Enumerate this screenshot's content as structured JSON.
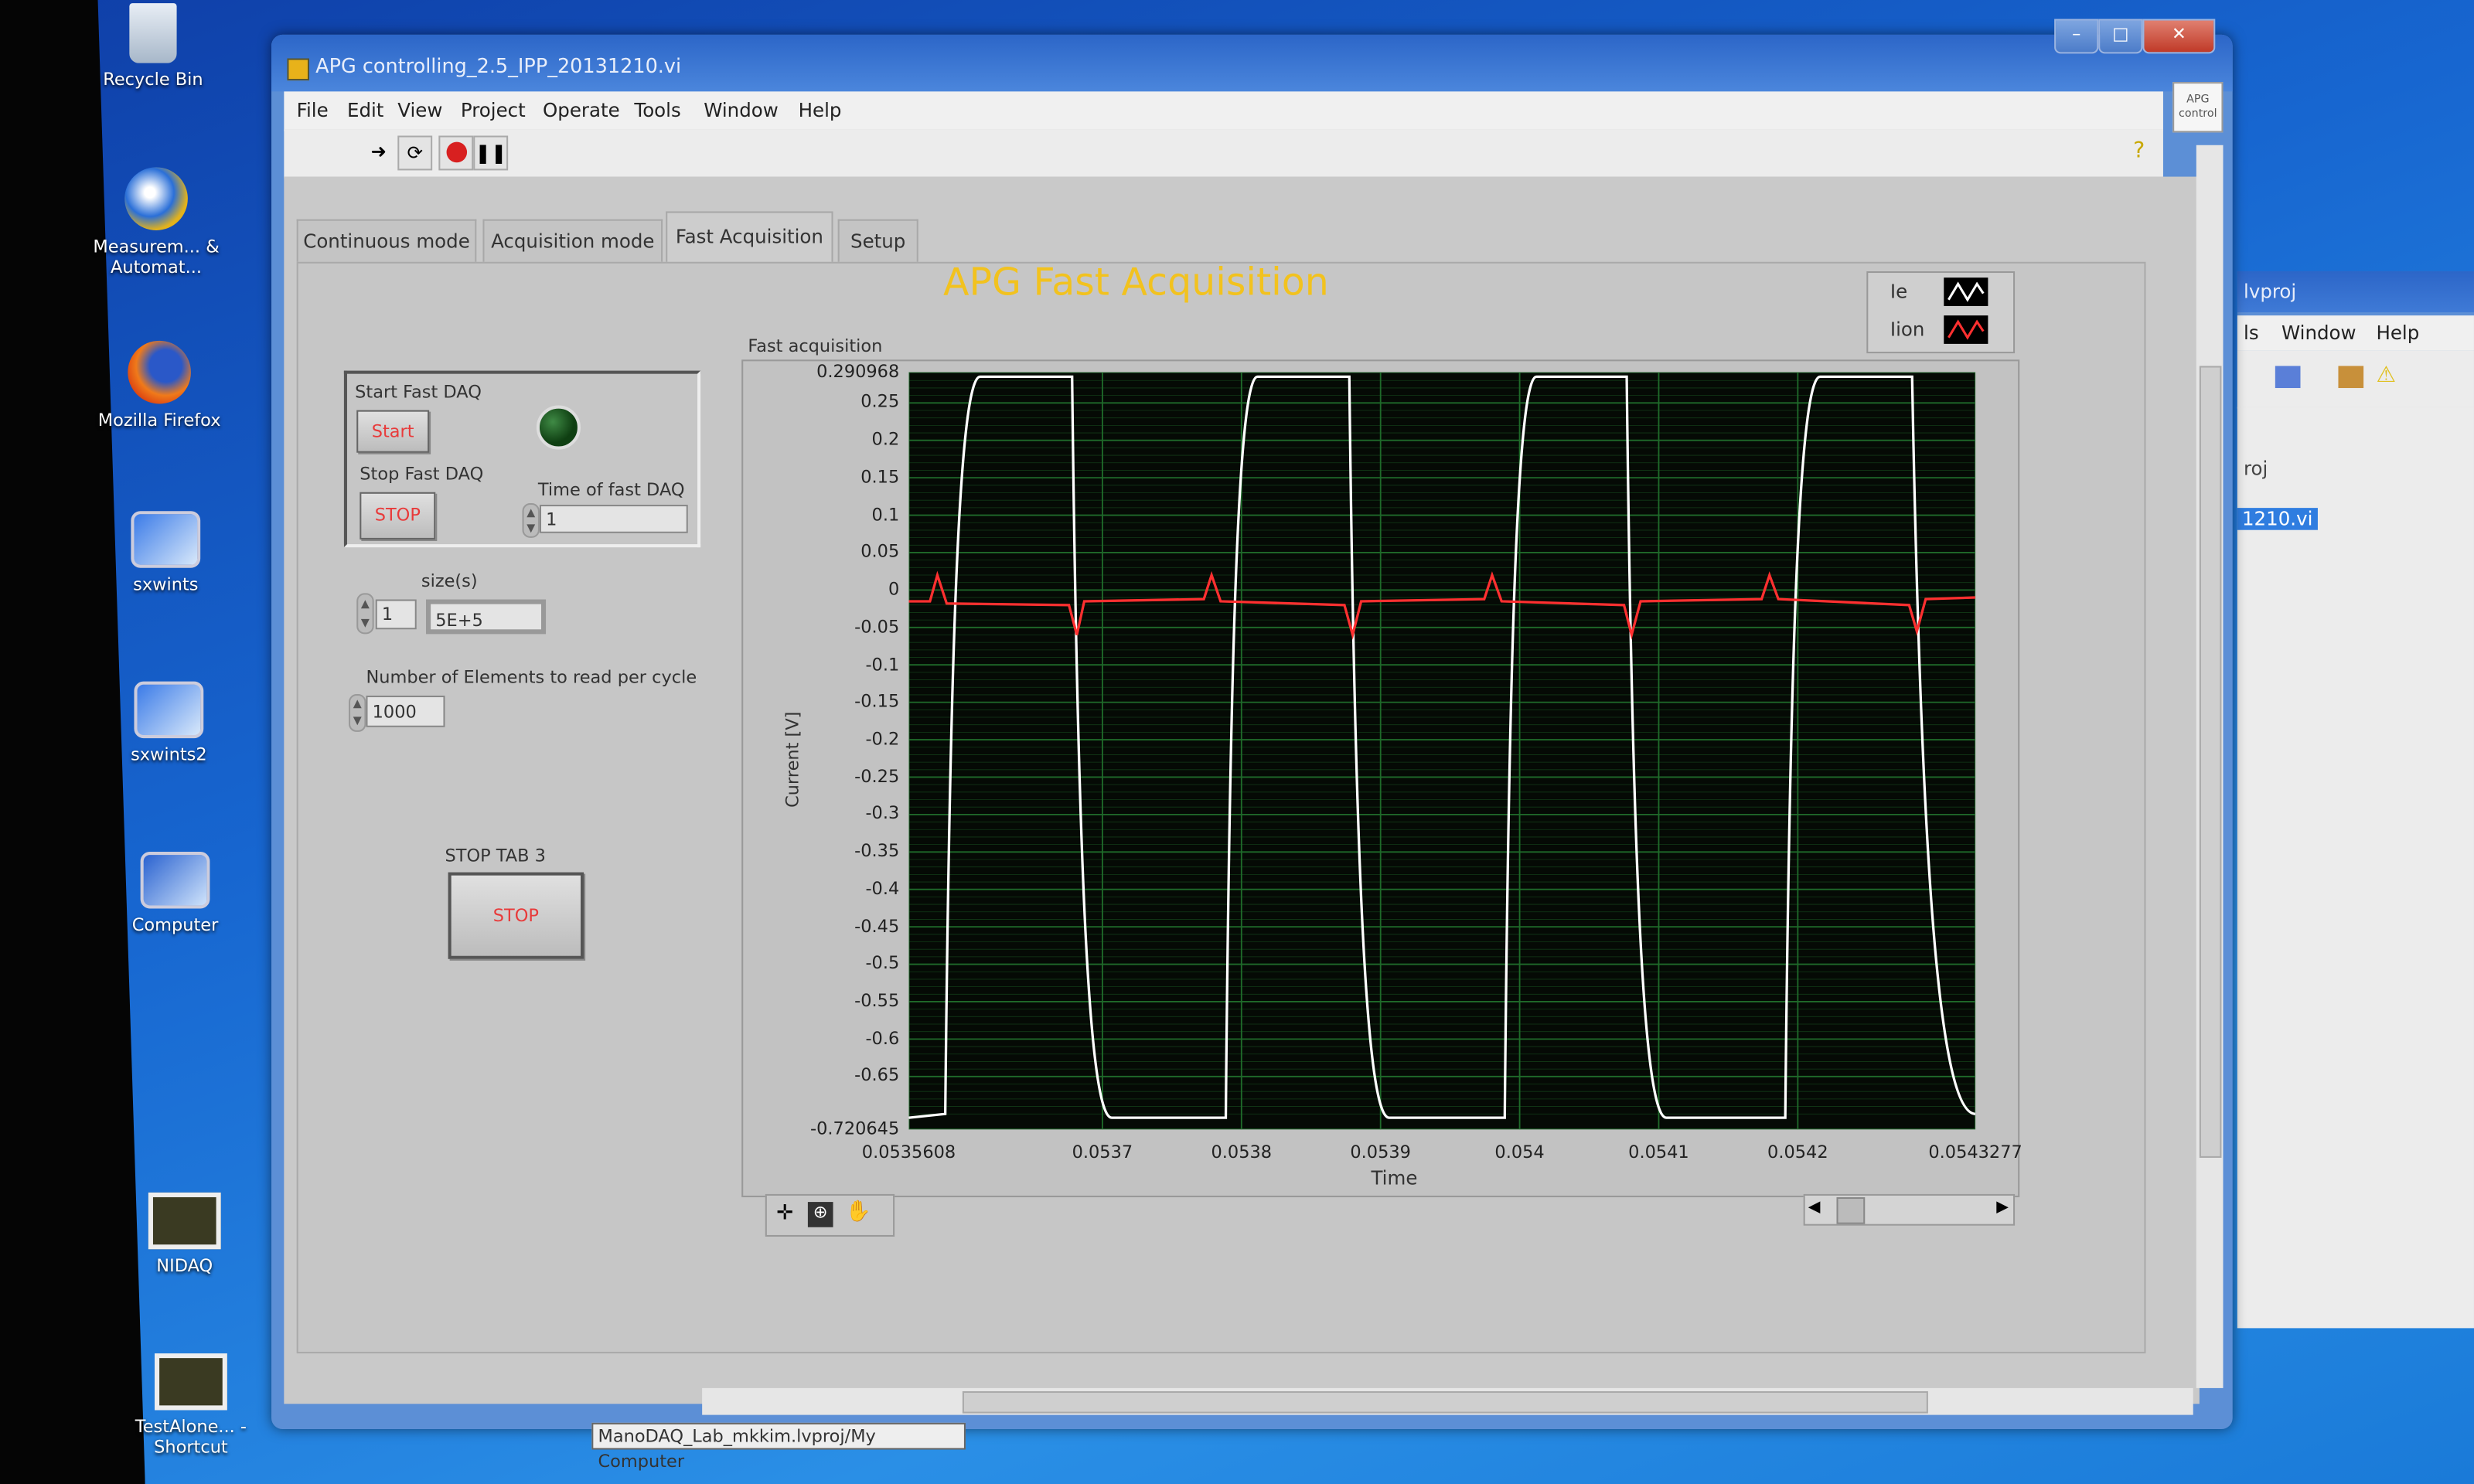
{
  "desktop": {
    "icons": [
      {
        "label": "Recycle Bin"
      },
      {
        "label": "Measurem... & Automat..."
      },
      {
        "label": "Mozilla Firefox"
      },
      {
        "label": "sxwints"
      },
      {
        "label": "sxwints2"
      },
      {
        "label": "Computer"
      },
      {
        "label": "NIDAQ"
      },
      {
        "label": "TestAlone... - Shortcut"
      }
    ]
  },
  "window": {
    "title": "APG controlling_2.5_IPP_20131210.vi",
    "menu": [
      "File",
      "Edit",
      "View",
      "Project",
      "Operate",
      "Tools",
      "Window",
      "Help"
    ],
    "apg_icon_label": "APG control",
    "tabs": [
      {
        "label": "Continuous mode",
        "active": false
      },
      {
        "label": "Acquisition mode",
        "active": false
      },
      {
        "label": "Fast Acquisition",
        "active": true
      },
      {
        "label": "Setup",
        "active": false
      }
    ],
    "status_path": "ManoDAQ_Lab_mkkim.lvproj/My Computer"
  },
  "fast_tab": {
    "title": "APG Fast Acquisition",
    "title_color": "#f2c21e",
    "start_label": "Start Fast DAQ",
    "start_button": "Start",
    "stop_label": "Stop Fast DAQ",
    "stop_button": "STOP",
    "led_state": "off",
    "led_color": "#0f3f12",
    "time_label": "Time of fast DAQ",
    "time_value": "1",
    "size_label": "size(s)",
    "size_index": "1",
    "size_value": "5E+5",
    "elements_label": "Number of Elements to read per cycle",
    "elements_value": "1000",
    "stop_tab_label": "STOP TAB 3",
    "stop_tab_button": "STOP"
  },
  "right_window": {
    "title": "lvproj",
    "menu": [
      "ls",
      "Window",
      "Help"
    ],
    "tree_item": "roj",
    "selected_item": "1210.vi"
  },
  "chart_data": {
    "type": "line",
    "title": "Fast acquisition",
    "xlabel": "Time",
    "ylabel": "Current [V]",
    "xlim": [
      0.0535608,
      0.0543277
    ],
    "ylim": [
      -0.720645,
      0.290968
    ],
    "xticks": [
      "0.0535608",
      "0.0537",
      "0.0538",
      "0.0539",
      "0.054",
      "0.0541",
      "0.0542",
      "0.0543277"
    ],
    "yticks": [
      "0.290968",
      "0.25",
      "0.2",
      "0.15",
      "0.1",
      "0.05",
      "0",
      "-0.05",
      "-0.1",
      "-0.15",
      "-0.2",
      "-0.25",
      "-0.3",
      "-0.35",
      "-0.4",
      "-0.45",
      "-0.5",
      "-0.55",
      "-0.6",
      "-0.65",
      "-0.720645"
    ],
    "grid": true,
    "background": "#050a05",
    "grid_color": "#1f6a2a",
    "legend_position": "top-right",
    "series": [
      {
        "name": "Ie",
        "color": "#ffffff",
        "x": [
          0.0535608,
          0.053587,
          0.0536121,
          0.0536782,
          0.0537067,
          0.0537887,
          0.0538115,
          0.0538776,
          0.0539061,
          0.0539893,
          0.0540121,
          0.054077,
          0.0541055,
          0.054191,
          0.0542161,
          0.0542822,
          0.0543277
        ],
        "y": [
          -0.705,
          -0.7,
          0.285,
          0.285,
          -0.705,
          -0.705,
          0.285,
          0.285,
          -0.705,
          -0.705,
          0.285,
          0.285,
          -0.705,
          -0.705,
          0.285,
          0.285,
          -0.7
        ]
      },
      {
        "name": "Iion",
        "color": "#ff3030",
        "x": [
          0.0535608,
          0.053576,
          0.0535813,
          0.053588,
          0.053676,
          0.0536816,
          0.053687,
          0.053773,
          0.0537785,
          0.053785,
          0.053874,
          0.0538799,
          0.053886,
          0.0539745,
          0.0539802,
          0.053987,
          0.054075,
          0.0540805,
          0.054087,
          0.054174,
          0.0541796,
          0.054186,
          0.05428,
          0.0542856,
          0.054292,
          0.0543277
        ],
        "y": [
          -0.015,
          -0.015,
          0.02,
          -0.018,
          -0.02,
          -0.06,
          -0.015,
          -0.012,
          0.02,
          -0.015,
          -0.02,
          -0.06,
          -0.015,
          -0.012,
          0.02,
          -0.015,
          -0.02,
          -0.06,
          -0.015,
          -0.012,
          0.02,
          -0.012,
          -0.02,
          -0.055,
          -0.012,
          -0.01
        ]
      }
    ]
  }
}
